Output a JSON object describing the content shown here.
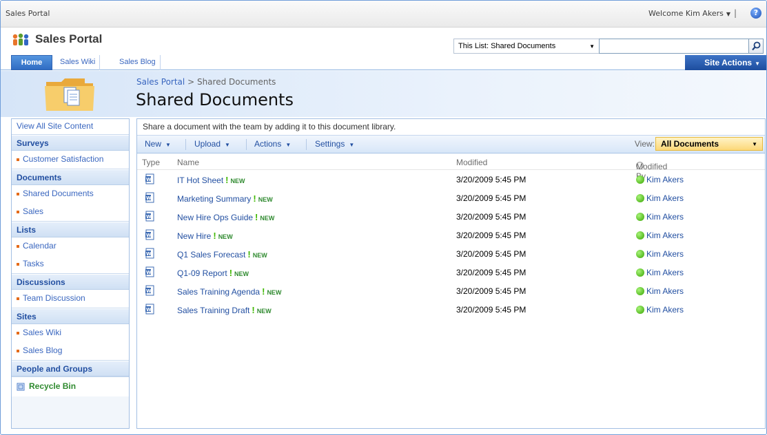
{
  "global": {
    "site_crumb": "Sales Portal",
    "welcome": "Welcome Kim Akers",
    "separator": "|"
  },
  "header": {
    "portal_title": "Sales Portal",
    "search_scope": "This List: Shared Documents",
    "search_value": "",
    "site_actions_label": "Site Actions"
  },
  "nav": {
    "tabs": [
      {
        "label": "Home"
      },
      {
        "label": "Sales Wiki"
      },
      {
        "label": "Sales Blog"
      }
    ]
  },
  "page": {
    "breadcrumb_parent": "Sales Portal",
    "breadcrumb_sep": ">",
    "breadcrumb_current": "Shared Documents",
    "title": "Shared Documents",
    "description": "Share a document with the team by adding it to this document library."
  },
  "sidebar": {
    "view_all": "View All Site Content",
    "groups": [
      {
        "header": "Surveys",
        "items": [
          "Customer Satisfaction"
        ]
      },
      {
        "header": "Documents",
        "items": [
          "Shared Documents",
          "Sales"
        ]
      },
      {
        "header": "Lists",
        "items": [
          "Calendar",
          "Tasks"
        ]
      },
      {
        "header": "Discussions",
        "items": [
          "Team Discussion"
        ]
      },
      {
        "header": "Sites",
        "items": [
          "Sales Wiki",
          "Sales Blog"
        ]
      },
      {
        "header": "People and Groups",
        "items": []
      }
    ],
    "recycle_bin": "Recycle Bin"
  },
  "toolbar": {
    "new_label": "New",
    "upload_label": "Upload",
    "actions_label": "Actions",
    "settings_label": "Settings",
    "view_label": "View:",
    "view_value": "All Documents"
  },
  "table": {
    "columns": {
      "type": "Type",
      "name": "Name",
      "modified": "Modified",
      "modified_by": "Modified By"
    },
    "new_badge": "NEW",
    "rows": [
      {
        "name": "IT Hot Sheet",
        "modified": "3/20/2009 5:45 PM",
        "modified_by": "Kim Akers"
      },
      {
        "name": "Marketing Summary",
        "modified": "3/20/2009 5:45 PM",
        "modified_by": "Kim Akers"
      },
      {
        "name": "New Hire Ops Guide",
        "modified": "3/20/2009 5:45 PM",
        "modified_by": "Kim Akers"
      },
      {
        "name": "New Hire",
        "modified": "3/20/2009 5:45 PM",
        "modified_by": "Kim Akers"
      },
      {
        "name": "Q1 Sales Forecast",
        "modified": "3/20/2009 5:45 PM",
        "modified_by": "Kim Akers"
      },
      {
        "name": "Q1-09 Report",
        "modified": "3/20/2009 5:45 PM",
        "modified_by": "Kim Akers"
      },
      {
        "name": "Sales Training Agenda",
        "modified": "3/20/2009 5:45 PM",
        "modified_by": "Kim Akers"
      },
      {
        "name": "Sales Training Draft",
        "modified": "3/20/2009 5:45 PM",
        "modified_by": "Kim Akers"
      }
    ]
  },
  "icons": {
    "help": "help-icon",
    "search": "search-icon",
    "logo": "people-logo-icon",
    "folder": "document-library-folder-icon",
    "doc": "word-document-icon",
    "presence": "presence-online-icon",
    "recycle": "recycle-bin-icon"
  },
  "colors": {
    "accent": "#224fa1",
    "active_tab": "#2f6cc3",
    "view_select": "#fcd879",
    "presence_online": "#37a400"
  }
}
